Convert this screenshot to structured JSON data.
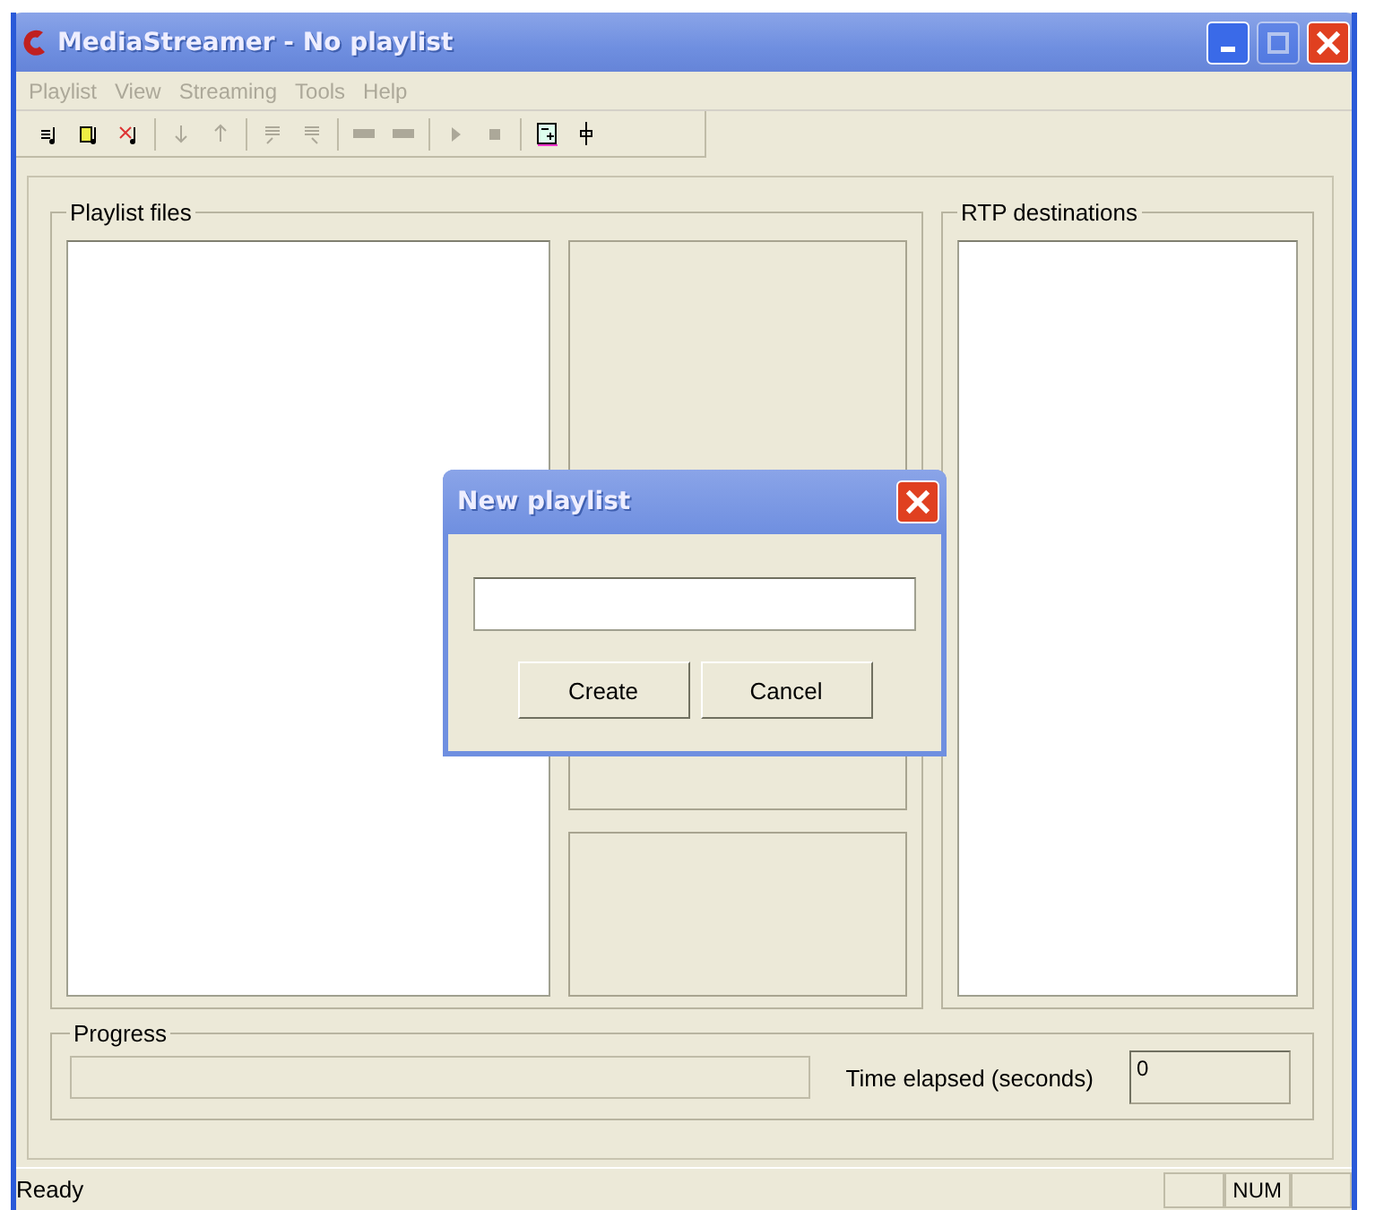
{
  "window": {
    "title": "MediaStreamer - No playlist",
    "maximize_disabled": true
  },
  "menu": [
    {
      "label": "Playlist",
      "disabled": true
    },
    {
      "label": "View",
      "disabled": true
    },
    {
      "label": "Streaming",
      "disabled": true
    },
    {
      "label": "Tools",
      "disabled": true
    },
    {
      "label": "Help",
      "disabled": true
    }
  ],
  "toolbar": [
    [
      {
        "kind": "note",
        "disabled": false
      },
      {
        "kind": "note-open",
        "disabled": false
      },
      {
        "kind": "note-delete",
        "disabled": false
      }
    ],
    [
      {
        "kind": "down",
        "disabled": true
      },
      {
        "kind": "up",
        "disabled": true
      }
    ],
    [
      {
        "kind": "top",
        "disabled": true
      },
      {
        "kind": "bottom",
        "disabled": true
      }
    ],
    [
      {
        "kind": "bar",
        "disabled": true
      },
      {
        "kind": "bar",
        "disabled": true
      }
    ],
    [
      {
        "kind": "play",
        "disabled": true
      },
      {
        "kind": "stop",
        "disabled": true
      }
    ],
    [
      {
        "kind": "add",
        "disabled": false
      },
      {
        "kind": "slider",
        "disabled": false
      }
    ]
  ],
  "playlist_files": {
    "label": "Playlist files"
  },
  "rtp_destinations": {
    "label": "RTP destinations"
  },
  "progress": {
    "label": "Progress",
    "level": 0,
    "time_label": "Time elapsed (seconds)",
    "time_value": "0"
  },
  "dialog": {
    "title": "New playlist",
    "buttons": [
      "Create",
      "Cancel"
    ]
  },
  "status_bar": {
    "text": "Ready",
    "panes": [
      {
        "kind": "blank"
      },
      {
        "kind": "text",
        "label": "NUM"
      },
      {
        "kind": "blank"
      }
    ]
  }
}
